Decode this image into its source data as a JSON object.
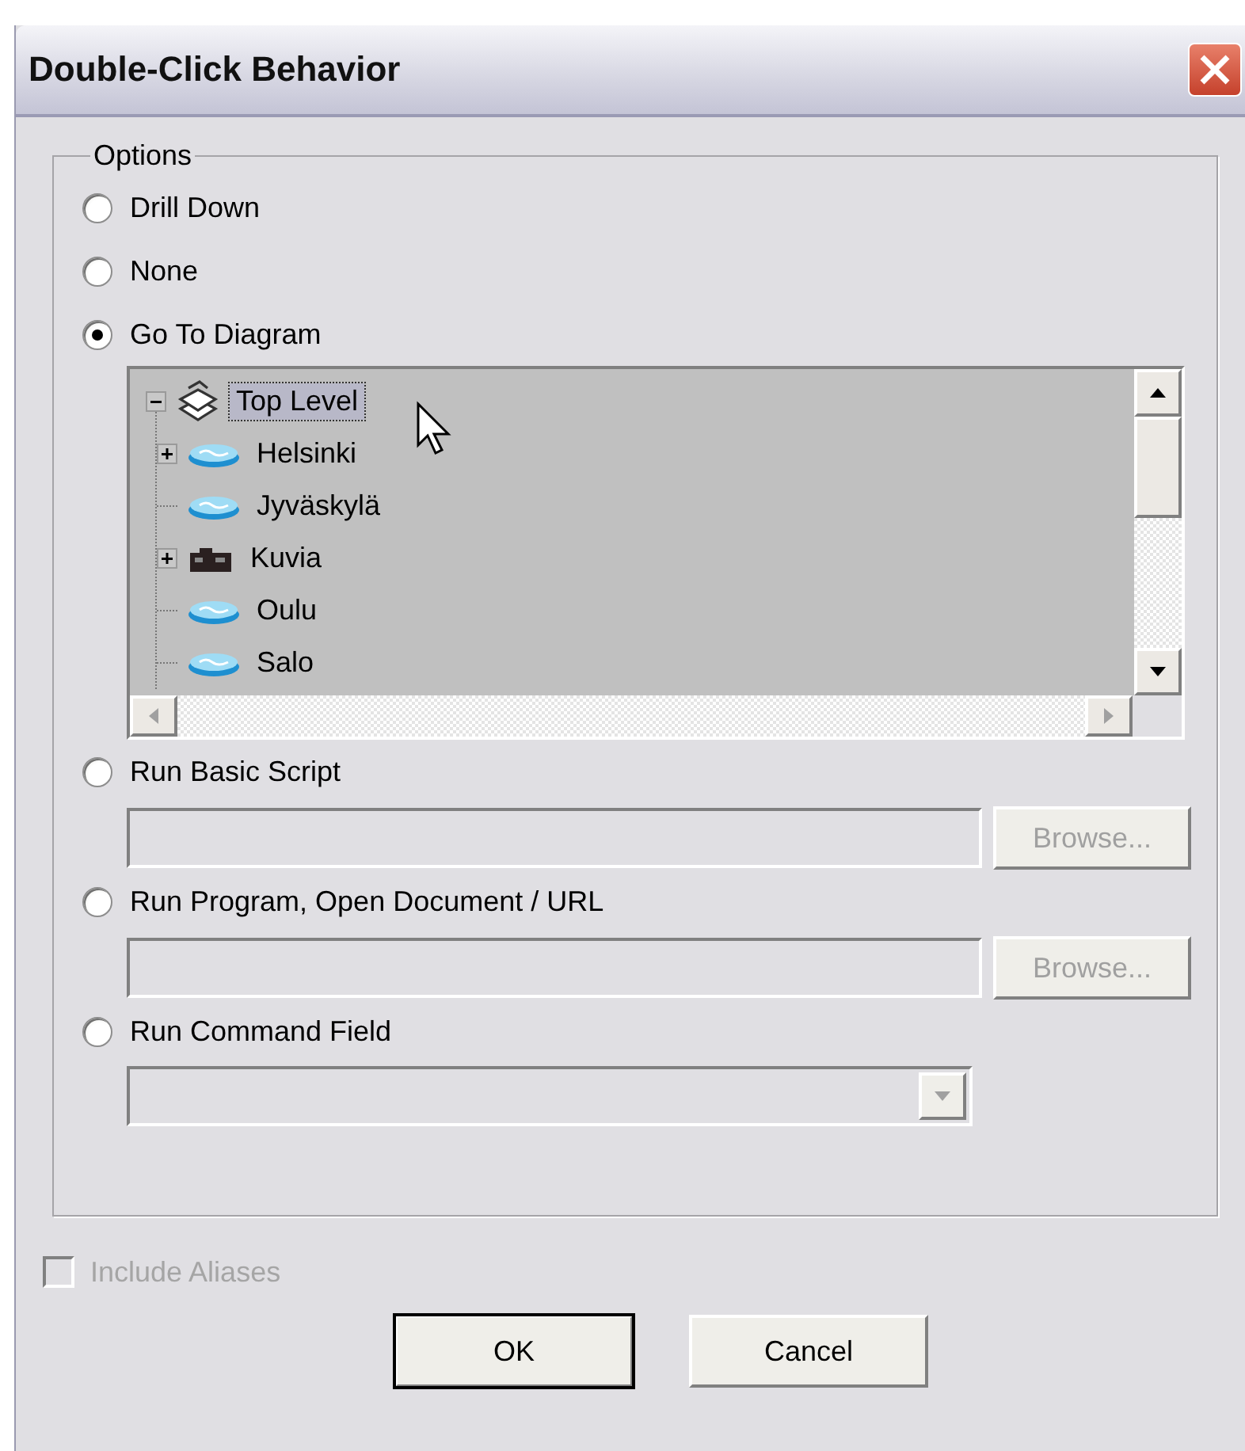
{
  "window": {
    "title": "Double-Click Behavior"
  },
  "options": {
    "legend": "Options",
    "items": [
      {
        "kind": "radio",
        "label": "Drill Down",
        "selected": false
      },
      {
        "kind": "radio",
        "label": "None",
        "selected": false
      },
      {
        "kind": "tree",
        "label": "Go To Diagram",
        "selected": true,
        "tree": [
          {
            "label": "Top Level",
            "kind": "stack",
            "expanded": true,
            "selected": true,
            "children": [
              {
                "label": "Helsinki",
                "kind": "diagram",
                "expanded": false,
                "selected": false
              },
              {
                "label": "Jyväskylä",
                "kind": "diagram",
                "selected": false
              },
              {
                "label": "Kuvia",
                "kind": "camera",
                "expanded": false,
                "selected": false
              },
              {
                "label": "Oulu",
                "kind": "diagram",
                "selected": false
              },
              {
                "label": "Salo",
                "kind": "diagram",
                "selected": false
              }
            ]
          }
        ]
      },
      {
        "kind": "file",
        "label": "Run Basic Script",
        "selected": false,
        "button": "Browse...",
        "disabled": true
      },
      {
        "kind": "file",
        "label": "Run Program, Open Document / URL",
        "selected": false,
        "button": "Browse...",
        "disabled": true
      },
      {
        "kind": "combo",
        "label": "Run Command Field",
        "selected": false,
        "disabled": true
      }
    ]
  },
  "include_aliases": {
    "label": "Include Aliases",
    "checked": false,
    "disabled": true
  },
  "buttons": [
    {
      "label": "OK",
      "default": true
    },
    {
      "label": "Cancel",
      "default": false
    }
  ]
}
